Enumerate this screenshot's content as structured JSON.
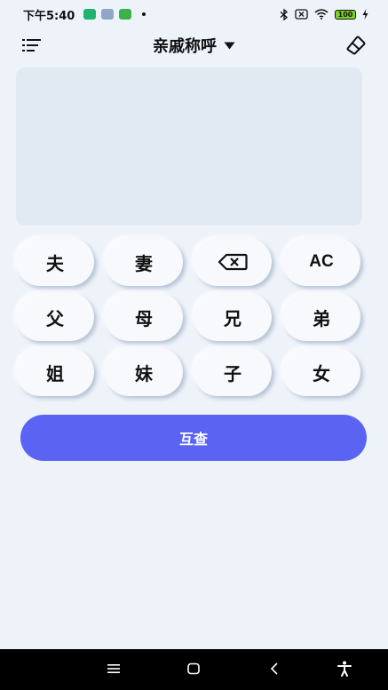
{
  "status_bar": {
    "time": "下午5:40",
    "battery": "100",
    "app_badges": [
      "#1fb36f",
      "#8fa6c8",
      "#38b24b"
    ]
  },
  "header": {
    "title": "亲戚称呼"
  },
  "keypad": {
    "keys": [
      "夫",
      "妻",
      "⌫",
      "AC",
      "父",
      "母",
      "兄",
      "弟",
      "姐",
      "妹",
      "子",
      "女"
    ]
  },
  "actions": {
    "query_label": "互查"
  },
  "colors": {
    "background": "#eef3fa",
    "display_panel": "#e1eaf3",
    "accent": "#5b63f3",
    "nav_bar": "#000000"
  }
}
